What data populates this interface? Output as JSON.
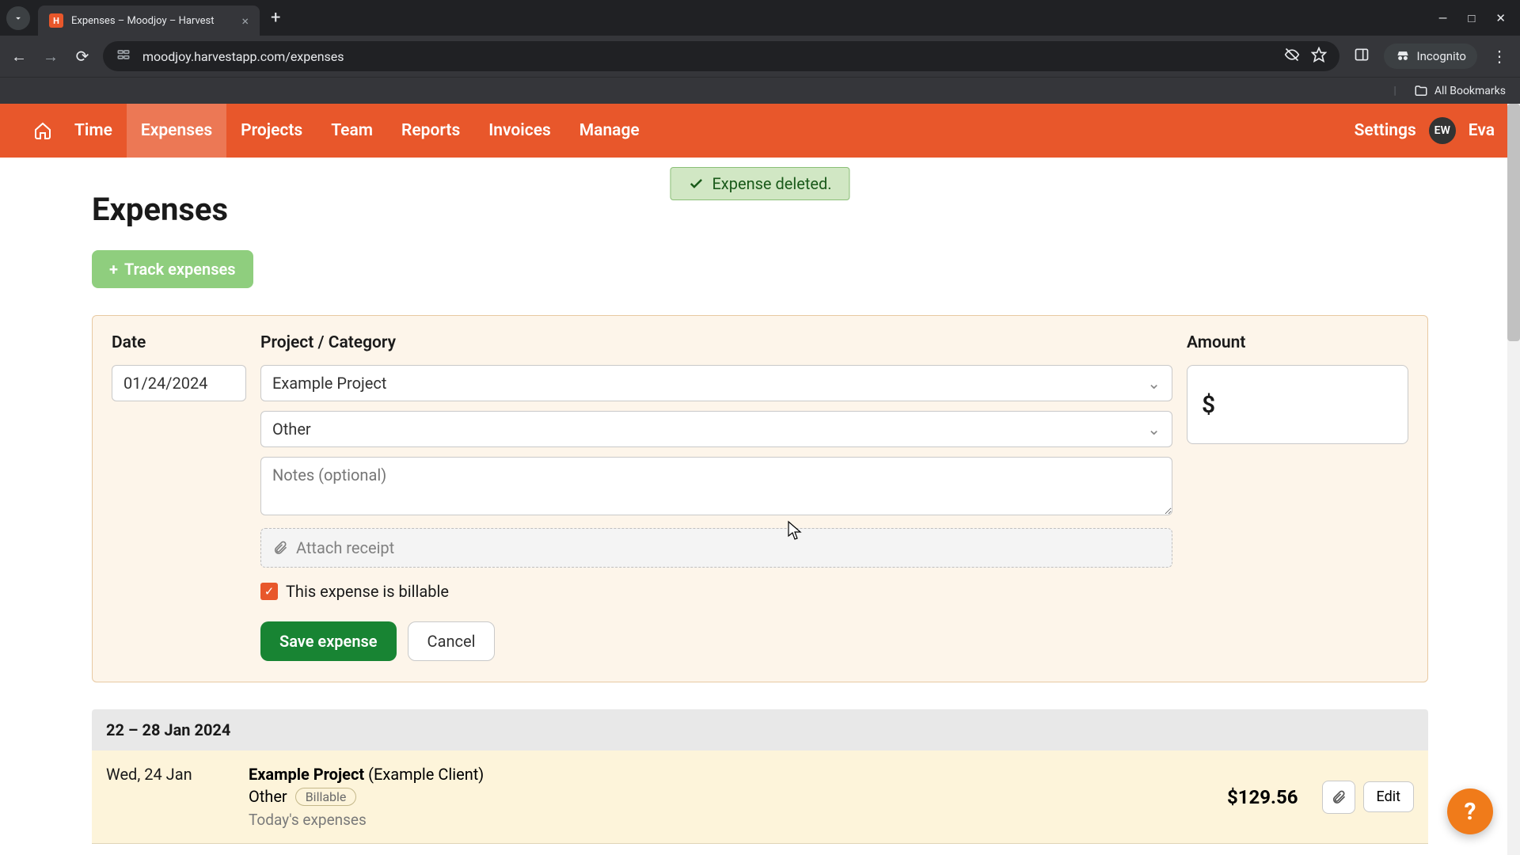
{
  "browser": {
    "tab_title": "Expenses – Moodjoy – Harvest",
    "url": "moodjoy.harvestapp.com/expenses",
    "incognito_label": "Incognito",
    "bookmarks_label": "All Bookmarks"
  },
  "nav": {
    "items": [
      "Time",
      "Expenses",
      "Projects",
      "Team",
      "Reports",
      "Invoices",
      "Manage"
    ],
    "active": "Expenses",
    "settings_label": "Settings",
    "user_initials": "EW",
    "user_name": "Eva"
  },
  "toast": {
    "text": "Expense deleted."
  },
  "page": {
    "title": "Expenses",
    "track_button": "Track expenses"
  },
  "form": {
    "labels": {
      "date": "Date",
      "project_category": "Project / Category",
      "amount": "Amount"
    },
    "date_value": "01/24/2024",
    "project_value": "Example Project",
    "category_value": "Other",
    "notes_placeholder": "Notes (optional)",
    "attach_label": "Attach receipt",
    "billable_label": "This expense is billable",
    "billable_checked": true,
    "currency_symbol": "$",
    "save_label": "Save expense",
    "cancel_label": "Cancel"
  },
  "list": {
    "range_label": "22 – 28 Jan 2024",
    "rows": [
      {
        "date": "Wed, 24 Jan",
        "project": "Example Project",
        "client": "(Example Client)",
        "category": "Other",
        "billable_tag": "Billable",
        "note": "Today's expenses",
        "amount": "$129.56",
        "edit_label": "Edit"
      }
    ]
  },
  "colors": {
    "brand": "#e8572b",
    "save_green": "#188433",
    "track_green": "#8fce7e"
  }
}
